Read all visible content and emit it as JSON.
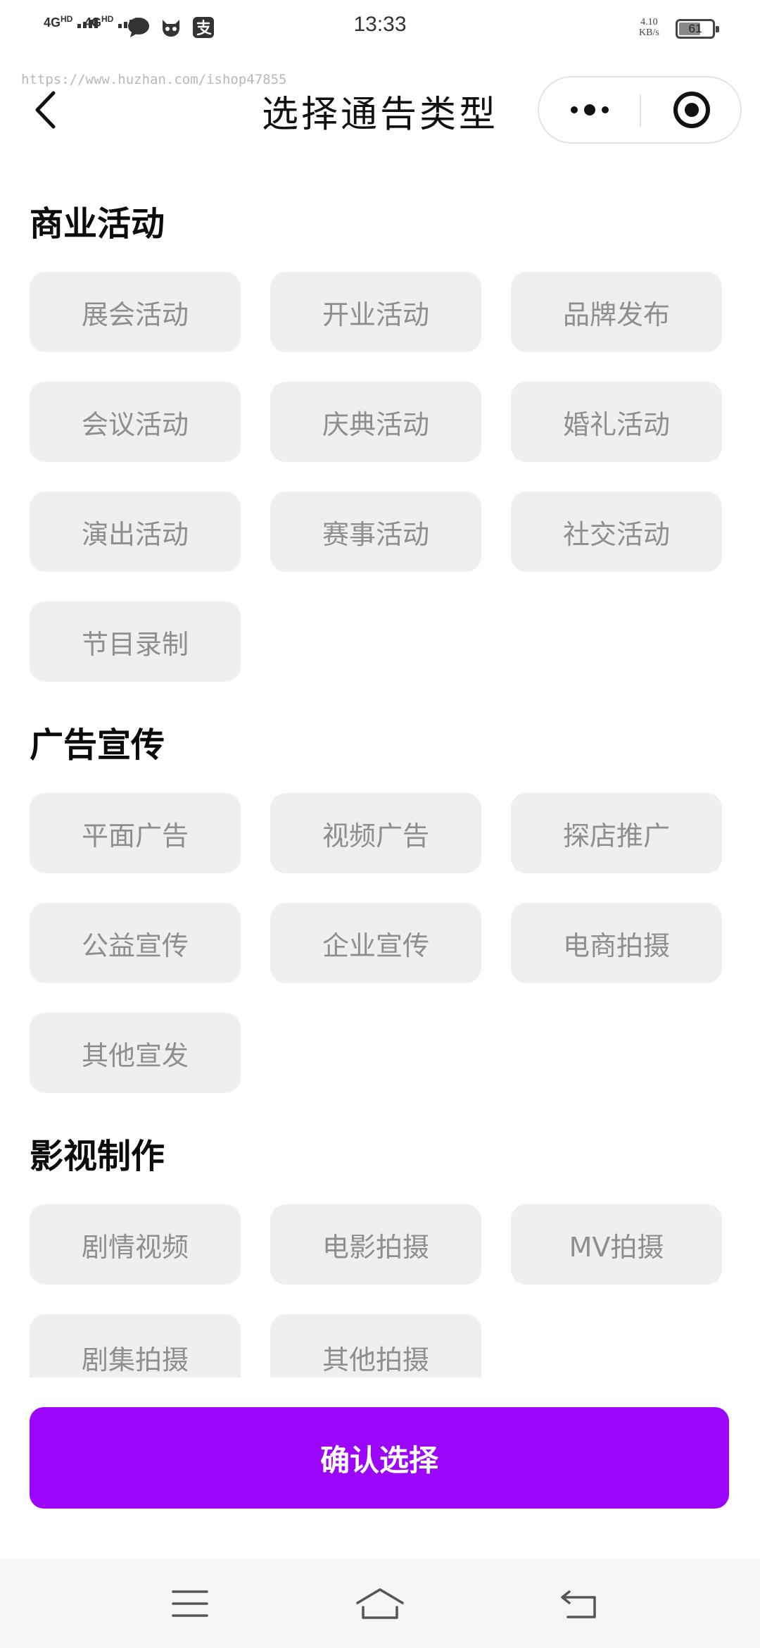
{
  "status_bar": {
    "signal_1": "4G",
    "signal_1_sup": "HD",
    "signal_2": "4G",
    "signal_2_sup": "HD",
    "icons": [
      "chat-bubble-icon",
      "mascot-icon",
      "alipay-icon"
    ],
    "time": "13:33",
    "net_speed_value": "4.10",
    "net_speed_unit": "KB/s",
    "battery_level": "61"
  },
  "watermark": "https://www.huzhan.com/ishop47855",
  "nav": {
    "title": "选择通告类型",
    "back_icon": "chevron-left-icon",
    "more_icon": "more-dots-icon",
    "close_icon": "target-circle-icon"
  },
  "sections": [
    {
      "title": "商业活动",
      "items": [
        "展会活动",
        "开业活动",
        "品牌发布",
        "会议活动",
        "庆典活动",
        "婚礼活动",
        "演出活动",
        "赛事活动",
        "社交活动",
        "节目录制"
      ]
    },
    {
      "title": "广告宣传",
      "items": [
        "平面广告",
        "视频广告",
        "探店推广",
        "公益宣传",
        "企业宣传",
        "电商拍摄",
        "其他宣发"
      ]
    },
    {
      "title": "影视制作",
      "items": [
        "剧情视频",
        "电影拍摄",
        "MV拍摄",
        "剧集拍摄",
        "其他拍摄"
      ]
    }
  ],
  "confirm_button": "确认选择",
  "colors": {
    "accent": "#9b05f9",
    "chip_background": "#efefef",
    "chip_text": "#8e8e8e"
  },
  "system_nav_icons": [
    "menu-icon",
    "home-icon",
    "back-return-icon"
  ]
}
